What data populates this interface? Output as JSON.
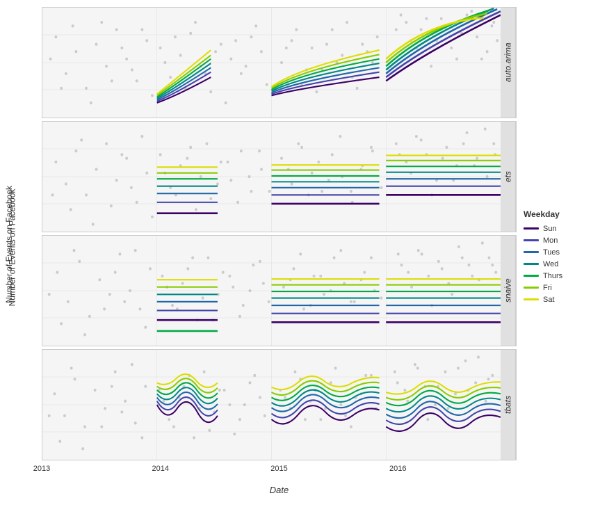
{
  "chart": {
    "title": "",
    "y_axis_label": "Number of Events on Facebook",
    "x_axis_label": "Date",
    "x_ticks": [
      "2013",
      "2014",
      "2015",
      "2016"
    ],
    "panels": [
      {
        "id": "auto_arima",
        "label": "auto.arima",
        "type": "auto_arima"
      },
      {
        "id": "ets",
        "label": "ets",
        "type": "ets"
      },
      {
        "id": "snaive",
        "label": "snaive",
        "type": "snaive"
      },
      {
        "id": "tbats",
        "label": "tbats",
        "type": "tbats"
      }
    ],
    "legend": {
      "title": "Weekday",
      "items": [
        {
          "label": "Sun",
          "color": "#3d0066"
        },
        {
          "label": "Mon",
          "color": "#4444aa"
        },
        {
          "label": "Tues",
          "color": "#2266aa"
        },
        {
          "label": "Wed",
          "color": "#008888"
        },
        {
          "label": "Thurs",
          "color": "#00aa44"
        },
        {
          "label": "Fri",
          "color": "#88cc00"
        },
        {
          "label": "Sat",
          "color": "#dddd00"
        }
      ]
    }
  }
}
